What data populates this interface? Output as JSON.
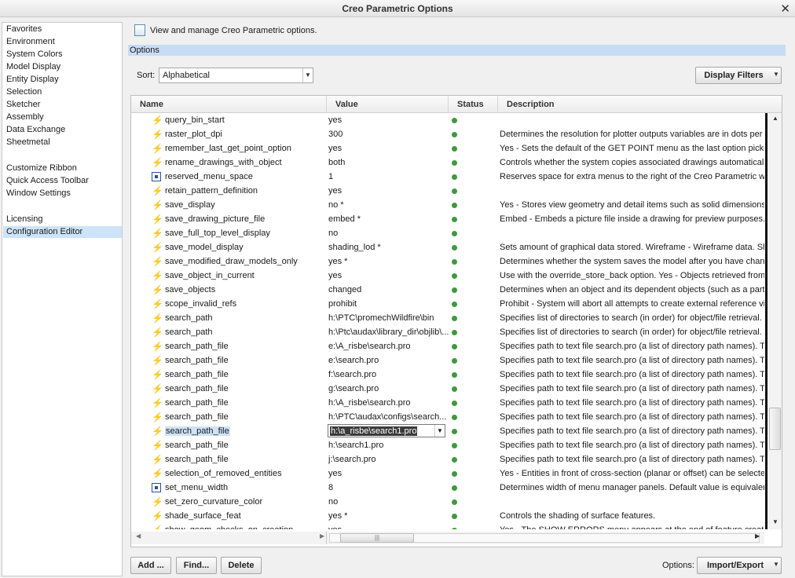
{
  "window": {
    "title": "Creo Parametric Options",
    "close_symbol": "✕"
  },
  "nav": {
    "items": [
      {
        "label": "Favorites"
      },
      {
        "label": "Environment"
      },
      {
        "label": "System Colors"
      },
      {
        "label": "Model Display"
      },
      {
        "label": "Entity Display"
      },
      {
        "label": "Selection"
      },
      {
        "label": "Sketcher"
      },
      {
        "label": "Assembly"
      },
      {
        "label": "Data Exchange"
      },
      {
        "label": "Sheetmetal"
      },
      {
        "label": "Customize Ribbon"
      },
      {
        "label": "Quick Access Toolbar"
      },
      {
        "label": "Window Settings"
      },
      {
        "label": "Licensing"
      },
      {
        "label": "Configuration Editor",
        "selected": true
      }
    ]
  },
  "header": {
    "text": "View and manage Creo Parametric options."
  },
  "options_bar": {
    "label": "Options"
  },
  "sort": {
    "label": "Sort:",
    "value": "Alphabetical"
  },
  "display_filters": {
    "label": "Display Filters"
  },
  "table": {
    "columns": [
      "Name",
      "Value",
      "Status",
      "Description"
    ],
    "rows": [
      {
        "icon": "bolt-icon",
        "name": "query_bin_start",
        "value": "yes",
        "desc": ""
      },
      {
        "icon": "bolt-icon",
        "name": "raster_plot_dpi",
        "value": "300",
        "desc": "Determines the resolution for plotter outputs variables are in dots per inch."
      },
      {
        "icon": "bolt-icon",
        "name": "remember_last_get_point_option",
        "value": "yes",
        "desc": "Yes - Sets the default of the GET POINT menu as the last option picked."
      },
      {
        "icon": "bolt-icon",
        "name": "rename_drawings_with_object",
        "value": "both",
        "desc": "Controls whether the system copies associated drawings automatically."
      },
      {
        "icon": "menu-icon",
        "name": "reserved_menu_space",
        "value": "1",
        "desc": "Reserves space for extra menus to the right of the Creo Parametric window."
      },
      {
        "icon": "bolt-icon",
        "name": "retain_pattern_definition",
        "value": "yes",
        "desc": ""
      },
      {
        "icon": "bolt-icon",
        "name": "save_display",
        "value": "no *",
        "desc": "Yes - Stores view geometry and detail items such as solid dimensions."
      },
      {
        "icon": "bolt-icon",
        "name": "save_drawing_picture_file",
        "value": "embed *",
        "desc": "Embed - Embeds a picture file inside a drawing for preview purposes."
      },
      {
        "icon": "bolt-icon",
        "name": "save_full_top_level_display",
        "value": "no",
        "desc": ""
      },
      {
        "icon": "bolt-icon",
        "name": "save_model_display",
        "value": "shading_lod *",
        "desc": "Sets amount of graphical data stored. Wireframe - Wireframe data. Shading."
      },
      {
        "icon": "bolt-icon",
        "name": "save_modified_draw_models_only",
        "value": "yes *",
        "desc": "Determines whether the system saves the model after you have changed it."
      },
      {
        "icon": "bolt-icon",
        "name": "save_object_in_current",
        "value": "yes",
        "desc": "Use with the override_store_back option. Yes - Objects retrieved from."
      },
      {
        "icon": "bolt-icon",
        "name": "save_objects",
        "value": "changed",
        "desc": "Determines when an object and its dependent objects (such as a part."
      },
      {
        "icon": "bolt-icon",
        "name": "scope_invalid_refs",
        "value": "prohibit",
        "desc": "Prohibit - System will abort all attempts to create external reference views."
      },
      {
        "icon": "bolt-icon",
        "name": "search_path",
        "value": "h:\\PTC\\promechWildfire\\bin",
        "desc": "Specifies list of directories to search (in order) for object/file retrieval."
      },
      {
        "icon": "bolt-icon",
        "name": "search_path",
        "value": "h:\\Ptc\\audax\\library_dir\\objlib\\...",
        "desc": "Specifies list of directories to search (in order) for object/file retrieval."
      },
      {
        "icon": "bolt-icon",
        "name": "search_path_file",
        "value": "e:\\A_risbe\\search.pro",
        "desc": "Specifies path to text file search.pro (a list of directory path names). T"
      },
      {
        "icon": "bolt-icon",
        "name": "search_path_file",
        "value": "e:\\search.pro",
        "desc": "Specifies path to text file search.pro (a list of directory path names). T"
      },
      {
        "icon": "bolt-icon",
        "name": "search_path_file",
        "value": "f:\\search.pro",
        "desc": "Specifies path to text file search.pro (a list of directory path names). T"
      },
      {
        "icon": "bolt-icon",
        "name": "search_path_file",
        "value": "g:\\search.pro",
        "desc": "Specifies path to text file search.pro (a list of directory path names). T"
      },
      {
        "icon": "bolt-icon",
        "name": "search_path_file",
        "value": "h:\\A_risbe\\search.pro",
        "desc": "Specifies path to text file search.pro (a list of directory path names). T"
      },
      {
        "icon": "bolt-icon",
        "name": "search_path_file",
        "value": "h:\\PTC\\audax\\configs\\search...",
        "desc": "Specifies path to text file search.pro (a list of directory path names). T"
      },
      {
        "icon": "bolt-icon",
        "name": "search_path_file",
        "value": "h:\\a_risbe\\search1.pro",
        "desc": "Specifies path to text file search.pro (a list of directory path names). T",
        "editing": true
      },
      {
        "icon": "bolt-icon",
        "name": "search_path_file",
        "value": "h:\\search1.pro",
        "desc": "Specifies path to text file search.pro (a list of directory path names). T"
      },
      {
        "icon": "bolt-icon",
        "name": "search_path_file",
        "value": "j:\\search.pro",
        "desc": "Specifies path to text file search.pro (a list of directory path names). T"
      },
      {
        "icon": "bolt-icon",
        "name": "selection_of_removed_entities",
        "value": "yes",
        "desc": "Yes - Entities in front of cross-section (planar or offset) can be selected."
      },
      {
        "icon": "menu-icon",
        "name": "set_menu_width",
        "value": "8",
        "desc": "Determines width of menu manager panels. Default value is equivalent."
      },
      {
        "icon": "bolt-icon",
        "name": "set_zero_curvature_color",
        "value": "no",
        "desc": ""
      },
      {
        "icon": "bolt-icon",
        "name": "shade_surface_feat",
        "value": "yes *",
        "desc": "Controls the shading of surface features."
      },
      {
        "icon": "bolt-icon",
        "name": "show_geom_checks_on_creation",
        "value": "yes",
        "desc": "Yes - The SHOW ERRORS menu appears at the end of feature creation."
      }
    ]
  },
  "buttons": {
    "add": "Add ...",
    "find": "Find...",
    "delete": "Delete"
  },
  "options_label": "Options:",
  "import_export": {
    "label": "Import/Export"
  },
  "colors": {
    "accent": "#cde3f7",
    "status_ok": "#3d9a3d"
  }
}
